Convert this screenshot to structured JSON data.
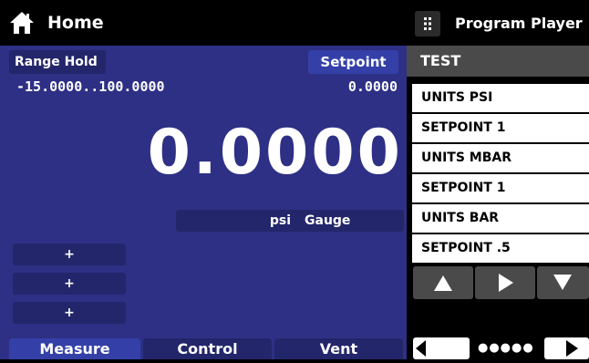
{
  "header": {
    "title": "Home",
    "home_icon": "home-icon"
  },
  "measure": {
    "range_hold_label": "Range Hold",
    "range": "-15.0000..100.0000",
    "setpoint_label": "Setpoint",
    "setpoint_value": "0.0000",
    "reading": "0.0000",
    "unit": "psi",
    "mode": "Gauge",
    "blank_buttons": [
      "+",
      "+",
      "+"
    ]
  },
  "tabs": [
    "Measure",
    "Control",
    "Vent"
  ],
  "program_player": {
    "title": "Program Player",
    "grid_icon": "grid-icon",
    "program_name": "TEST",
    "steps": [
      "UNITS PSI",
      "SETPOINT 1",
      "UNITS MBAR",
      "SETPOINT 1",
      "UNITS BAR",
      "SETPOINT .5"
    ],
    "page_indicator": "●●●●●",
    "arrow_icons": [
      "up-arrow-icon",
      "play-icon",
      "down-arrow-icon"
    ],
    "nav_icons": [
      "previous-icon",
      "next-icon"
    ]
  },
  "colors": {
    "panel_blue": "#2e3085",
    "chip_blue": "#23266a",
    "active_blue": "#3440a8",
    "gray": "#4a4a4a"
  }
}
